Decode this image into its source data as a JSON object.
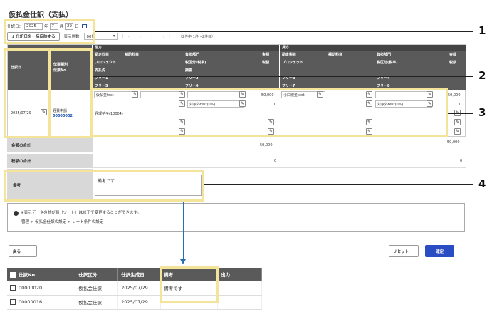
{
  "page": {
    "title": "仮払金仕訳（支払）"
  },
  "date": {
    "label": "仕訳日：",
    "year": "2025",
    "year_unit": "年",
    "month": "7",
    "month_unit": "月",
    "day": "29",
    "day_unit": "日"
  },
  "toolbar": {
    "bulk_button": "↓ 仕訳日を一括反映する",
    "display_count_label": "表示件数",
    "display_count_value": "00件",
    "pager": "|‹ ‹ › ›|",
    "pager_count": "（2件中 1件〜2件目）"
  },
  "grid": {
    "col_date": "仕訳日",
    "col_slip": "伝票種別\n伝票No.",
    "debit": {
      "title": "借方",
      "row1": [
        "勘定科目",
        "補助科目",
        "負担部門",
        "金額"
      ],
      "row2": [
        "プロジェクト",
        "税区分(税率)",
        "税額"
      ],
      "row3": [
        "支払先",
        "摘要"
      ],
      "free": [
        "フリー1",
        "フリー2",
        "フリー5",
        "フリー6"
      ]
    },
    "credit": {
      "title": "貸方",
      "row1": [
        "勘定科目",
        "補助科目",
        "負担部門",
        "金額"
      ],
      "row2": [
        "プロジェクト",
        "税区分(税率)",
        "税額"
      ],
      "free": [
        "フリー3",
        "フリー4",
        "フリー7",
        "フリー8"
      ]
    },
    "row": {
      "date": "2025/07/29",
      "slip_type": "経費申請",
      "slip_no": "00000002",
      "debit_account": "仮払金test",
      "debit_amount": "50,000",
      "debit_tax_class": "対象外test(0%)",
      "debit_tax": "0",
      "payee": "経理花子(10004)",
      "credit_account": "小口現金test",
      "credit_amount": "50,000",
      "credit_tax_class": "対象外test(0%)",
      "credit_tax": "0"
    }
  },
  "totals": {
    "amount_label": "金額の合計",
    "amount_debit": "50,000",
    "amount_credit": "50,000",
    "tax_label": "税額の合計",
    "tax_debit": "0",
    "tax_credit": "0"
  },
  "remark": {
    "label": "備考",
    "value": "備考です"
  },
  "info": {
    "line1": "※表示データの並び順（ソート）は以下で変更することができます。",
    "line2": "管理 > 仮払金仕訳の設定 > ソート条件の設定"
  },
  "footer": {
    "back": "戻る",
    "reset": "リセット",
    "confirm": "確定"
  },
  "list": {
    "headers": [
      "仕訳No.",
      "仕訳区分",
      "仕訳生成日",
      "備考",
      "出力"
    ],
    "rows": [
      [
        "00000020",
        "仮払金仕訳",
        "2025/07/29",
        "備考です",
        ""
      ],
      [
        "00000016",
        "仮払金仕訳",
        "2025/07/29",
        "",
        ""
      ]
    ]
  },
  "callouts": [
    "1",
    "2",
    "3",
    "4"
  ],
  "colors": {
    "highlight": "#f3e49a",
    "header_dark": "#5a5a5a",
    "primary": "#2b4dc4",
    "arrow": "#2a6db0"
  }
}
